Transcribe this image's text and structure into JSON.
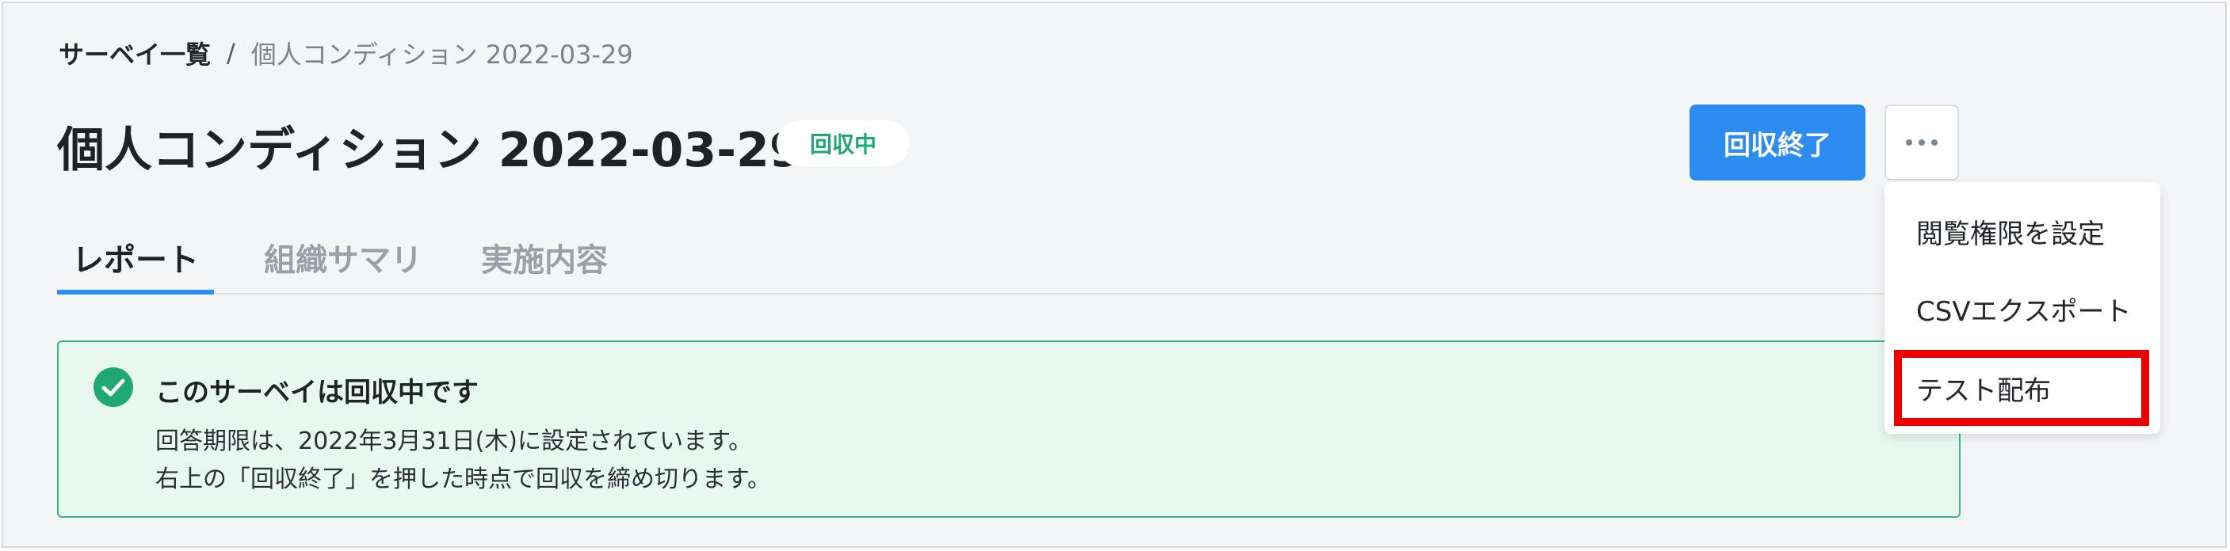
{
  "breadcrumb": {
    "root": "サーベイ一覧",
    "separator": "/",
    "current": "個人コンディション 2022-03-29"
  },
  "header": {
    "title": "個人コンディション 2022-03-29",
    "status_badge": "回収中",
    "primary_button": "回収終了",
    "more_icon": "more-horizontal-icon"
  },
  "tabs": [
    {
      "label": "レポート",
      "active": true
    },
    {
      "label": "組織サマリ",
      "active": false
    },
    {
      "label": "実施内容",
      "active": false
    }
  ],
  "alert": {
    "icon": "check-circle-icon",
    "title": "このサーベイは回収中です",
    "line1": "回答期限は、2022年3月31日(木)に設定されています。",
    "line2": "右上の「回収終了」を押した時点で回収を締め切ります。"
  },
  "menu": {
    "items": [
      "閲覧権限を設定",
      "CSVエクスポート",
      "テスト配布"
    ],
    "highlighted_index": 2
  },
  "colors": {
    "accent": "#2d8cf0",
    "success": "#1fa874",
    "alert_bg": "#e8f8f1",
    "highlight": "#ee0000"
  }
}
